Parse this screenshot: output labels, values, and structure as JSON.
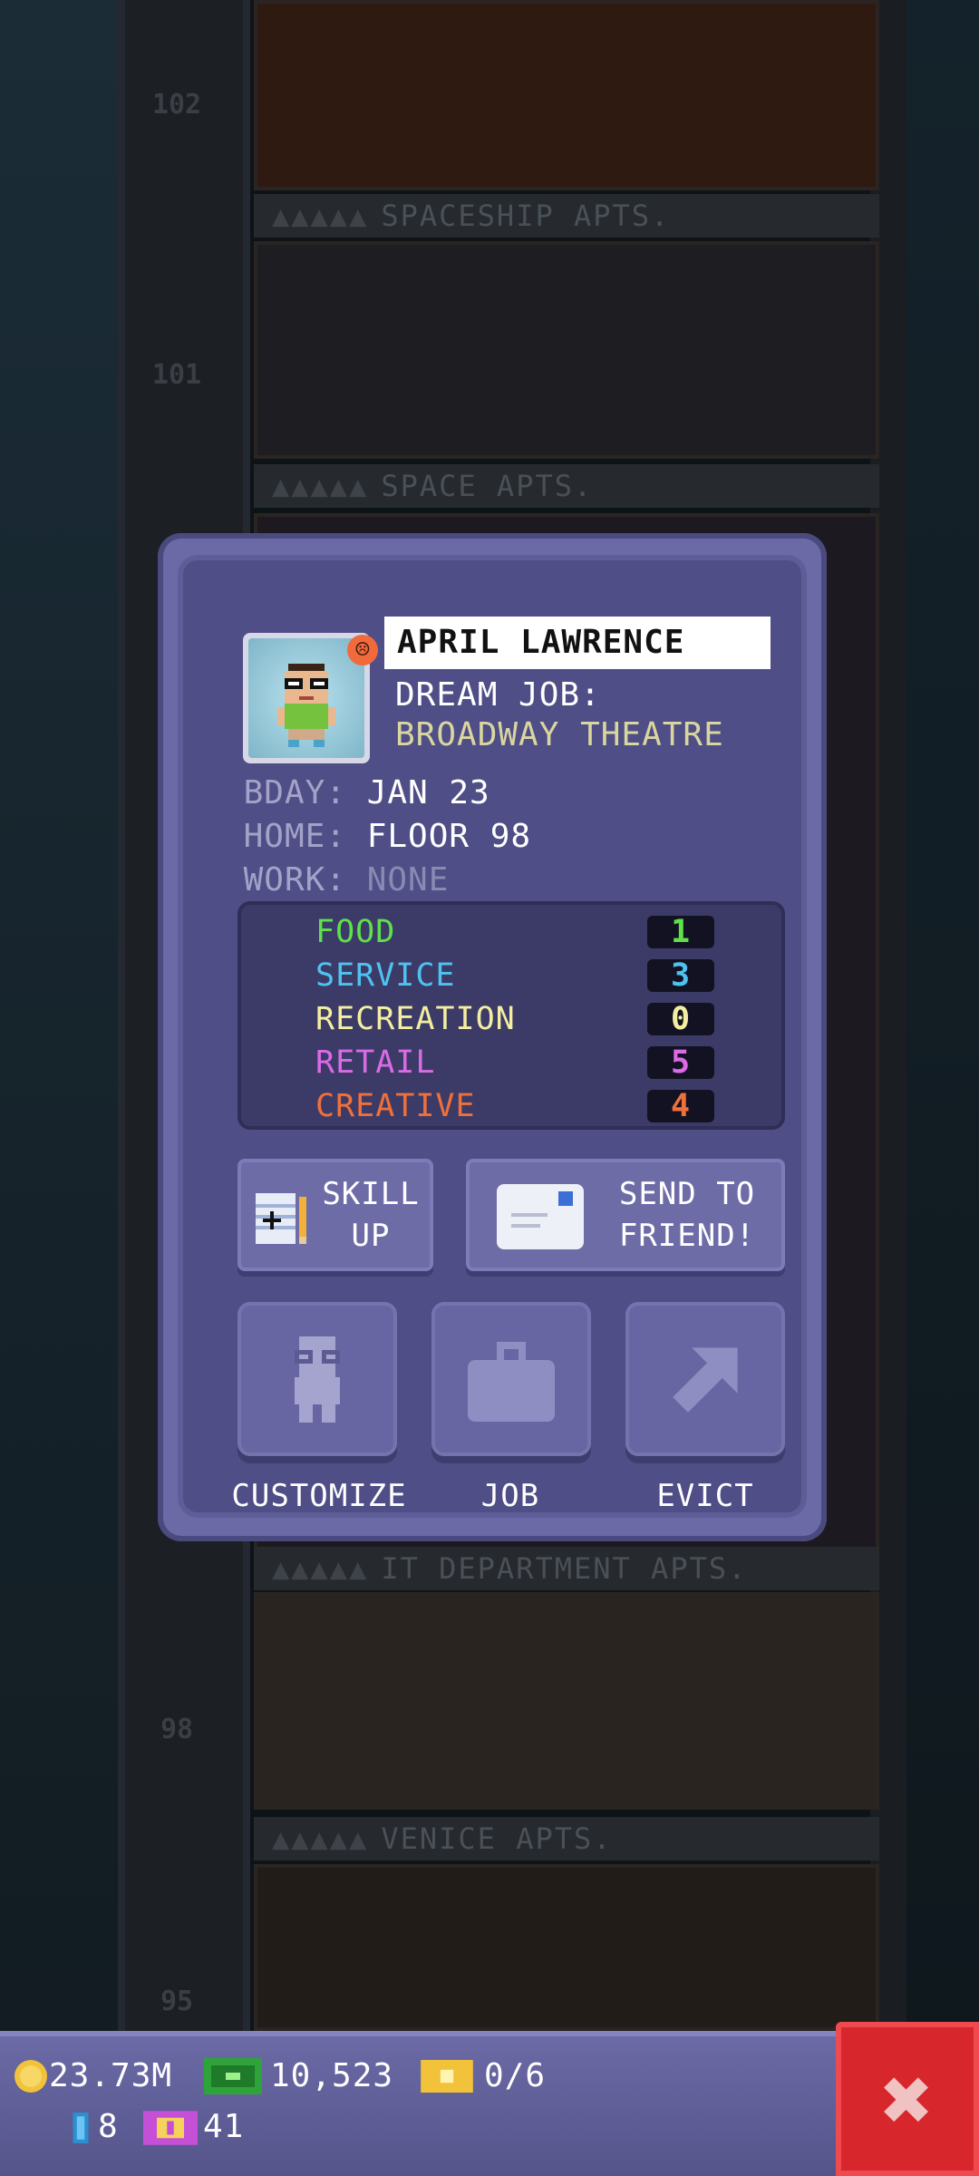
{
  "tower": {
    "floor_numbers": [
      "102",
      "101",
      "98",
      "95"
    ],
    "floor_signs": [
      "SPACESHIP APTS.",
      "SPACE APTS.",
      "IT DEPARTMENT APTS.",
      "VENICE APTS."
    ],
    "sign_pips": "▲▲▲▲▲"
  },
  "bitizen": {
    "name": "APRIL LAWRENCE",
    "mood": "unhappy-face-icon",
    "dream_job_label": "DREAM JOB:",
    "dream_job_value": "BROADWAY THEATRE",
    "bday_label": "BDAY:",
    "bday_value": "JAN 23",
    "home_label": "HOME:",
    "home_value": "FLOOR 98",
    "work_label": "WORK:",
    "work_value": "NONE"
  },
  "skills": [
    {
      "label": "FOOD",
      "value": "1",
      "color": "#5ee04a"
    },
    {
      "label": "SERVICE",
      "value": "3",
      "color": "#4fc3f0"
    },
    {
      "label": "RECREATION",
      "value": "0",
      "color": "#f4eea0"
    },
    {
      "label": "RETAIL",
      "value": "5",
      "color": "#dc6ae6"
    },
    {
      "label": "CREATIVE",
      "value": "4",
      "color": "#f0703a"
    }
  ],
  "buttons": {
    "skill_up": "SKILL UP",
    "send_to_friend": "SEND TO FRIEND!",
    "customize": "CUSTOMIZE",
    "job": "JOB",
    "evict": "EVICT"
  },
  "status_bar": {
    "coins": "23.73M",
    "bux": "10,523",
    "tickets": "0/6",
    "keys": "8",
    "vip": "41"
  },
  "colors": {
    "modal": "#6b6aa6",
    "close": "#d7262c",
    "dream_job": "#d9d6a0"
  }
}
